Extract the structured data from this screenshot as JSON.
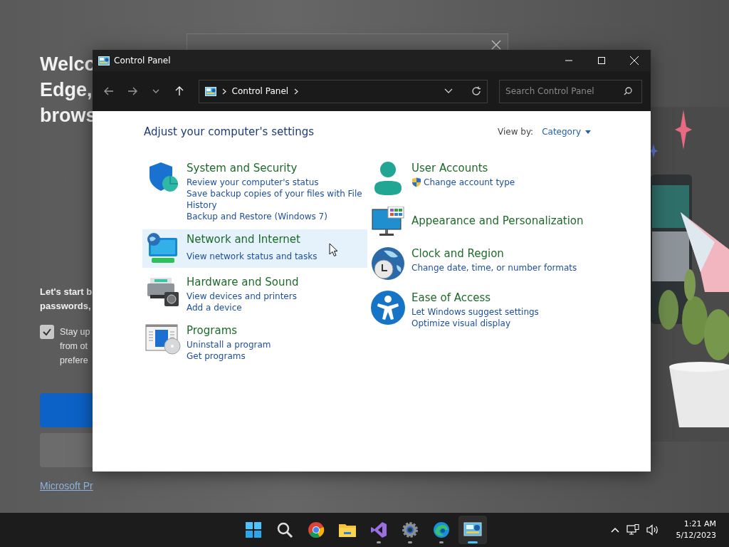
{
  "background_page": {
    "heading_lines": [
      "Welco",
      "Edge,",
      "brows"
    ],
    "intro_lines": [
      "Let's start b",
      "passwords,"
    ],
    "option": {
      "checked": true,
      "lines": [
        "Stay up",
        "from ot",
        "prefere"
      ]
    },
    "link": "Microsoft Pr"
  },
  "window": {
    "title": "Control Panel",
    "address": {
      "crumbs": [
        "Control Panel"
      ]
    },
    "search": {
      "placeholder": "Search Control Panel"
    },
    "heading": "Adjust your computer's settings",
    "view_by": {
      "label": "View by:",
      "value": "Category"
    },
    "columns": [
      [
        {
          "title": "System and Security",
          "highlighted": false,
          "links": [
            {
              "text": "Review your computer's status",
              "shield": false
            },
            {
              "text": "Save backup copies of your files with File History",
              "shield": false
            },
            {
              "text": "Backup and Restore (Windows 7)",
              "shield": false
            }
          ]
        },
        {
          "title": "Network and Internet",
          "highlighted": true,
          "links": [
            {
              "text": "View network status and tasks",
              "shield": false
            }
          ]
        },
        {
          "title": "Hardware and Sound",
          "highlighted": false,
          "links": [
            {
              "text": "View devices and printers",
              "shield": false
            },
            {
              "text": "Add a device",
              "shield": false
            }
          ]
        },
        {
          "title": "Programs",
          "highlighted": false,
          "links": [
            {
              "text": "Uninstall a program",
              "shield": false
            },
            {
              "text": "Get programs",
              "shield": false
            }
          ]
        }
      ],
      [
        {
          "title": "User Accounts",
          "highlighted": false,
          "links": [
            {
              "text": "Change account type",
              "shield": true
            }
          ]
        },
        {
          "title": "Appearance and Personalization",
          "highlighted": false
        },
        {
          "title": "Clock and Region",
          "highlighted": false,
          "links": [
            {
              "text": "Change date, time, or number formats",
              "shield": false
            }
          ]
        },
        {
          "title": "Ease of Access",
          "highlighted": false,
          "links": [
            {
              "text": "Let Windows suggest settings",
              "shield": false
            },
            {
              "text": "Optimize visual display",
              "shield": false
            }
          ]
        }
      ]
    ]
  },
  "taskbar": {
    "apps": [
      {
        "running": false,
        "active": false
      },
      {
        "running": false,
        "active": false
      },
      {
        "running": false,
        "active": false
      },
      {
        "running": false,
        "active": false
      },
      {
        "running": true,
        "active": false
      },
      {
        "running": true,
        "active": false
      },
      {
        "running": true,
        "active": false
      },
      {
        "running": true,
        "active": true
      }
    ],
    "clock": {
      "time": "1:21 AM",
      "date": "5/12/2023"
    }
  }
}
